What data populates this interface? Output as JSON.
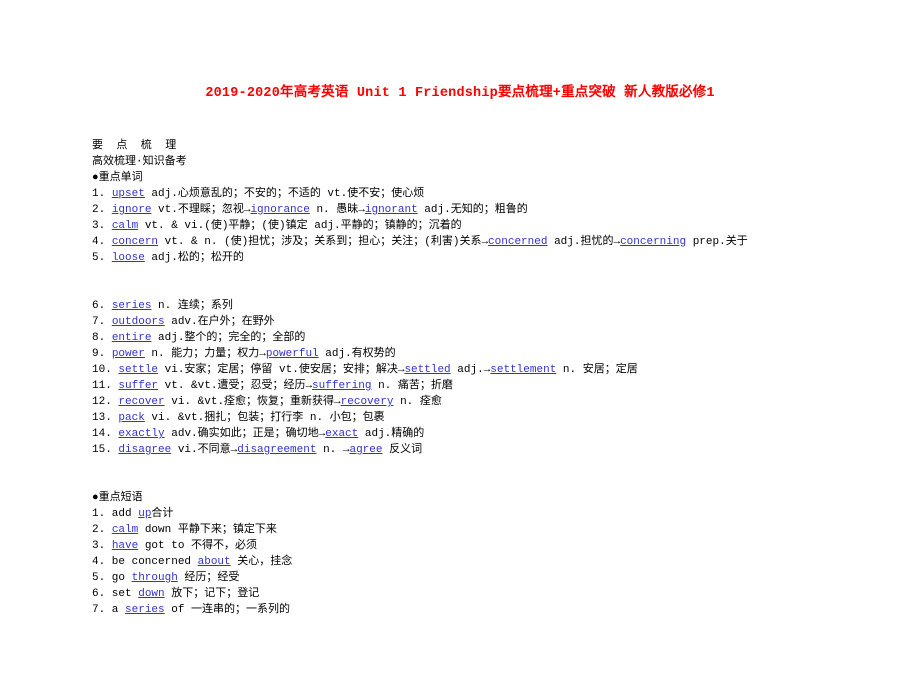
{
  "document": {
    "title": "2019-2020年高考英语 Unit 1 Friendship要点梳理+重点突破 新人教版必修1",
    "title_color": "#ff0000",
    "link_color": "#3232cd",
    "body_color": "#000000",
    "background_color": "#ffffff"
  },
  "headings": {
    "section_title": "要 点 梳 理",
    "subtitle": "高效梳理·知识备考",
    "key_words_heading": "●重点单词",
    "key_phrases_heading": "●重点短语"
  },
  "key_words": [
    {
      "num": "1.",
      "word": "upset",
      "rest": " adj.心烦意乱的；不安的；不适的 vt.使不安；使心烦"
    },
    {
      "num": "2.",
      "word": "ignore",
      "rest": " vt.不理睬；忽视→",
      "word2": "ignorance",
      "rest2": " n. 愚昧→",
      "word3": "ignorant",
      "rest3": " adj.无知的；粗鲁的"
    },
    {
      "num": "3.",
      "word": "calm",
      "rest": " vt. & vi.(使)平静；(使)镇定  adj.平静的；镇静的；沉着的"
    },
    {
      "num": "4.",
      "word": "concern",
      "rest": " vt. & n. (使)担忧；涉及；关系到；担心；关注；(利害)关系→",
      "word2": "concerned",
      "rest2": " adj.担忧的→",
      "word3": "concerning",
      "rest3": " prep.关于"
    },
    {
      "num": "5.",
      "word": "loose",
      "rest": " adj.松的；松开的"
    },
    {
      "num": "6.",
      "word": "series",
      "rest": " n. 连续；系列"
    },
    {
      "num": "7.",
      "word": "outdoors",
      "rest": " adv.在户外；在野外"
    },
    {
      "num": "8.",
      "word": "entire",
      "rest": " adj.整个的；完全的；全部的"
    },
    {
      "num": "9.",
      "word": "power",
      "rest": " n. 能力；力量；权力→",
      "word2": "powerful",
      "rest2": " adj.有权势的"
    },
    {
      "num": "10.",
      "word": "settle",
      "rest": " vi.安家；定居；停留 vt.使安居；安排；解决→",
      "word2": "settled",
      "rest2": " adj.→",
      "word3": "settlement",
      "rest3": " n. 安居；定居"
    },
    {
      "num": "11.",
      "word": "suffer",
      "rest": " vt. &vt.遭受；忍受；经历→",
      "word2": "suffering",
      "rest2": " n. 痛苦；折磨"
    },
    {
      "num": "12.",
      "word": "recover",
      "rest": " vi. &vt.痊愈；恢复；重新获得→",
      "word2": "recovery",
      "rest2": " n. 痊愈"
    },
    {
      "num": "13.",
      "word": "pack",
      "rest": " vi. &vt.捆扎；包装；打行李 n. 小包；包裹"
    },
    {
      "num": "14.",
      "word": "exactly",
      "rest": " adv.确实如此；正是；确切地→",
      "word2": "exact",
      "rest2": " adj.精确的"
    },
    {
      "num": "15.",
      "word": "disagree",
      "rest": " vi.不同意→",
      "word2": "disagreement",
      "rest2": " n. →",
      "word3": "agree",
      "rest3": " 反义词"
    }
  ],
  "key_phrases": [
    {
      "num": "1.",
      "pre": " add ",
      "word": "up",
      "post": "合计"
    },
    {
      "num": "2.",
      "pre": " ",
      "word": "calm",
      "post": " down  平静下来；镇定下来"
    },
    {
      "num": "3.",
      "pre": " ",
      "word": "have",
      "post": " got to  不得不，必须"
    },
    {
      "num": "4.",
      "pre": " be concerned ",
      "word": "about",
      "post": "  关心，挂念"
    },
    {
      "num": "5.",
      "pre": " go ",
      "word": "through",
      "post": "  经历；经受"
    },
    {
      "num": "6.",
      "pre": " set ",
      "word": "down",
      "post": "  放下；记下；登记"
    },
    {
      "num": "7.",
      "pre": " a ",
      "word": "series",
      "post": " of  一连串的；一系列的"
    }
  ]
}
